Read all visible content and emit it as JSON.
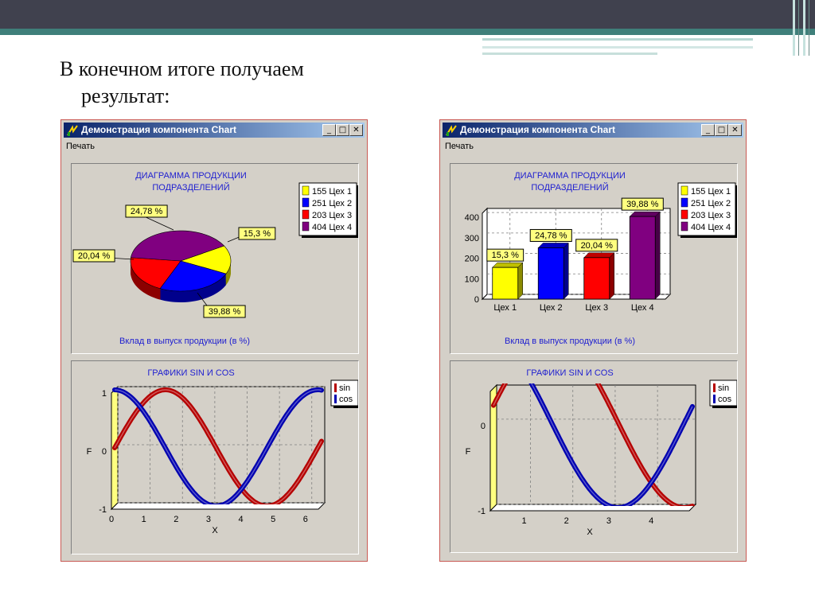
{
  "slide": {
    "line1": "В конечном итоге получаем",
    "line2": "результат:"
  },
  "windows": [
    {
      "title": "Демонстрация компонента Chart",
      "menu": "Печать",
      "minimize": "_",
      "maximize": "□",
      "close": "✕"
    },
    {
      "title": "Демонстрация компонента Chart",
      "menu": "Печать",
      "minimize": "_",
      "maximize": "□",
      "close": "✕"
    }
  ],
  "colors": {
    "window_bg": "#d4d0c8",
    "title_blue": "#0a246a",
    "chart_title": "#2020d0",
    "tooltip": "#ffff80",
    "sin_color": "#b50000",
    "cos_color": "#0000b0"
  },
  "chart_data": [
    {
      "type": "pie",
      "title": "ДИАГРАММА ПРОДУКЦИИ\nПОДРАЗДЕЛЕНИЙ",
      "caption": "Вклад в выпуск продукции (в %)",
      "categories": [
        "Цех 1",
        "Цех 2",
        "Цех 3",
        "Цех 4"
      ],
      "values": [
        155,
        251,
        203,
        404
      ],
      "legend": [
        "155 Цех 1",
        "251 Цех 2",
        "203 Цех 3",
        "404 Цех 4"
      ],
      "slice_labels": [
        "15,3 %",
        "24,78 %",
        "20,04 %",
        "39,88 %"
      ],
      "colors": [
        "#ffff00",
        "#0000ff",
        "#ff0000",
        "#800080"
      ],
      "legend_placement": "top-right"
    },
    {
      "type": "bar",
      "title": "ДИАГРАММА ПРОДУКЦИИ\nПОДРАЗДЕЛЕНИЙ",
      "caption": "Вклад в выпуск продукции (в %)",
      "categories": [
        "Цех 1",
        "Цех 2",
        "Цех 3",
        "Цех 4"
      ],
      "values": [
        155,
        251,
        203,
        404
      ],
      "legend": [
        "155 Цех 1",
        "251 Цех 2",
        "203 Цех 3",
        "404 Цех 4"
      ],
      "bar_labels": [
        "15,3 %",
        "24,78 %",
        "20,04 %",
        "39,88 %"
      ],
      "colors": [
        "#ffff00",
        "#0000ff",
        "#ff0000",
        "#800080"
      ],
      "yticks": [
        "0",
        "100",
        "200",
        "300",
        "400"
      ],
      "ylim": [
        0,
        420
      ],
      "grid": true,
      "legend_placement": "top-right"
    },
    {
      "type": "line",
      "title": "ГРАФИКИ SIN И COS",
      "xlabel": "X",
      "ylabel": "F",
      "xlim": [
        0,
        6.4
      ],
      "ylim": [
        -1,
        1
      ],
      "xticks": [
        "0",
        "1",
        "2",
        "3",
        "4",
        "5",
        "6"
      ],
      "yticks": [
        "-1",
        "0",
        "1"
      ],
      "series": [
        {
          "name": "sin",
          "function": "sin",
          "color": "#b50000"
        },
        {
          "name": "cos",
          "function": "cos",
          "color": "#0000b0"
        }
      ],
      "grid": true,
      "legend_placement": "top-right"
    },
    {
      "type": "line",
      "title": "ГРАФИКИ SIN И COS",
      "xlabel": "X",
      "ylabel": "F",
      "xlim": [
        0.2,
        4.9
      ],
      "ylim": [
        -1,
        0.4
      ],
      "xticks": [
        "1",
        "2",
        "3",
        "4"
      ],
      "yticks": [
        "-1",
        "0"
      ],
      "series": [
        {
          "name": "sin",
          "function": "sin",
          "color": "#b50000"
        },
        {
          "name": "cos",
          "function": "cos",
          "color": "#0000b0"
        }
      ],
      "grid": true,
      "legend_placement": "top-right"
    }
  ]
}
